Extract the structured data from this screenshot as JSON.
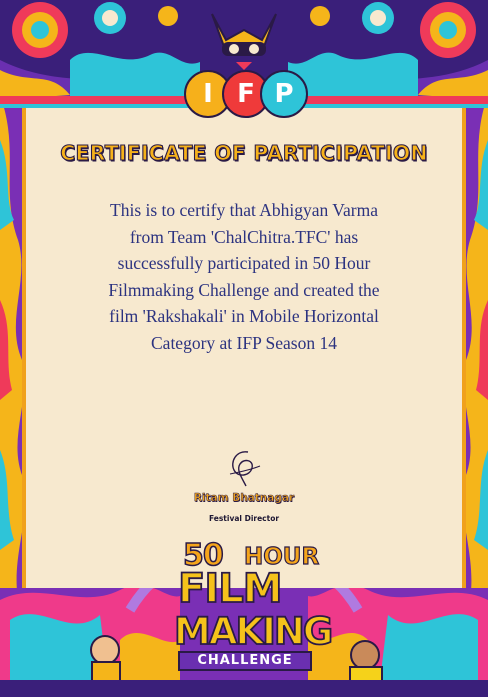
{
  "header": {
    "logo_letters": [
      "I",
      "F",
      "P"
    ],
    "logo_colors": [
      "#f6b01b",
      "#ef3a3a",
      "#2ec4d8"
    ]
  },
  "certificate": {
    "title": "CERTIFICATE OF PARTICIPATION",
    "body_lines": [
      "This is to certify that Abhigyan Varma",
      "from Team 'ChalChitra.TFC' has",
      "successfully participated in 50 Hour",
      "Filmmaking Challenge and created the",
      "film 'Rakshakali' in Mobile Horizontal",
      "Category at IFP Season 14"
    ]
  },
  "signature": {
    "name": "Ritam Bhatnagar",
    "role": "Festival Director"
  },
  "event_logo": {
    "number": "50",
    "hour": "HOUR",
    "film": "FILM",
    "making": "MAKING",
    "challenge": "CHALLENGE"
  },
  "colors": {
    "background": "#f7e9cf",
    "title_fill": "#f6b21a",
    "body_text": "#2c3380",
    "frame_orange": "#f0a11c"
  }
}
